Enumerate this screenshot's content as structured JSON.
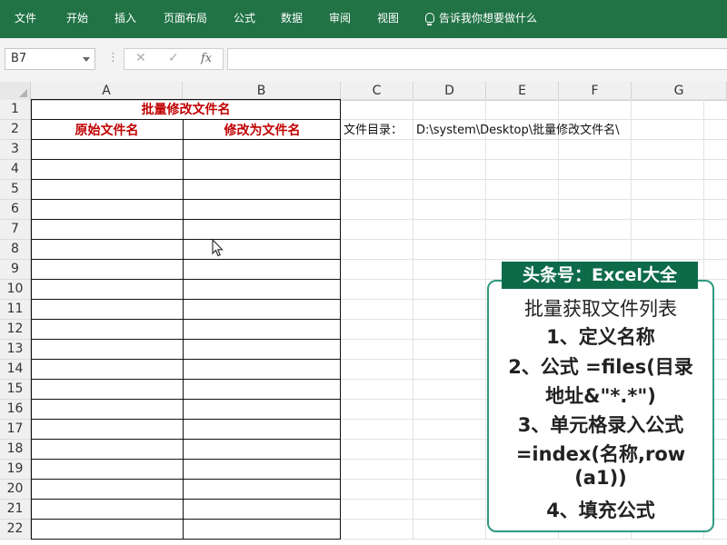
{
  "ribbon": {
    "tabs": [
      "文件",
      "开始",
      "插入",
      "页面布局",
      "公式",
      "数据",
      "审阅",
      "视图"
    ],
    "tell_me": "告诉我你想要做什么"
  },
  "formula_bar": {
    "name_box": "B7",
    "cancel_symbol": "✕",
    "enter_symbol": "✓",
    "fx_label": "fx",
    "formula": ""
  },
  "sheet": {
    "columns": [
      "A",
      "B",
      "C",
      "D",
      "E",
      "F",
      "G"
    ],
    "rows": [
      "1",
      "2",
      "3",
      "4",
      "5",
      "6",
      "7",
      "8",
      "9",
      "10",
      "11",
      "12",
      "13",
      "14",
      "15",
      "16",
      "17",
      "18",
      "19",
      "20",
      "21",
      "22"
    ],
    "title": "批量修改文件名",
    "header_original": "原始文件名",
    "header_new": "修改为文件名",
    "dir_label": "文件目录：",
    "dir_path": "D:\\system\\Desktop\\批量修改文件名\\"
  },
  "info_box": {
    "badge": "头条号：Excel大全",
    "lines": [
      "批量获取文件列表",
      "1、定义名称",
      "2、公式 =files(目录",
      "地址&\"*.*\")",
      "3、单元格录入公式",
      "=index(名称,row",
      "(a1))",
      "4、填充公式"
    ]
  },
  "colors": {
    "ribbon_bg": "#217346",
    "title_red": "#c00000",
    "badge_green": "#0d6b4a",
    "box_border": "#2f9a80"
  }
}
